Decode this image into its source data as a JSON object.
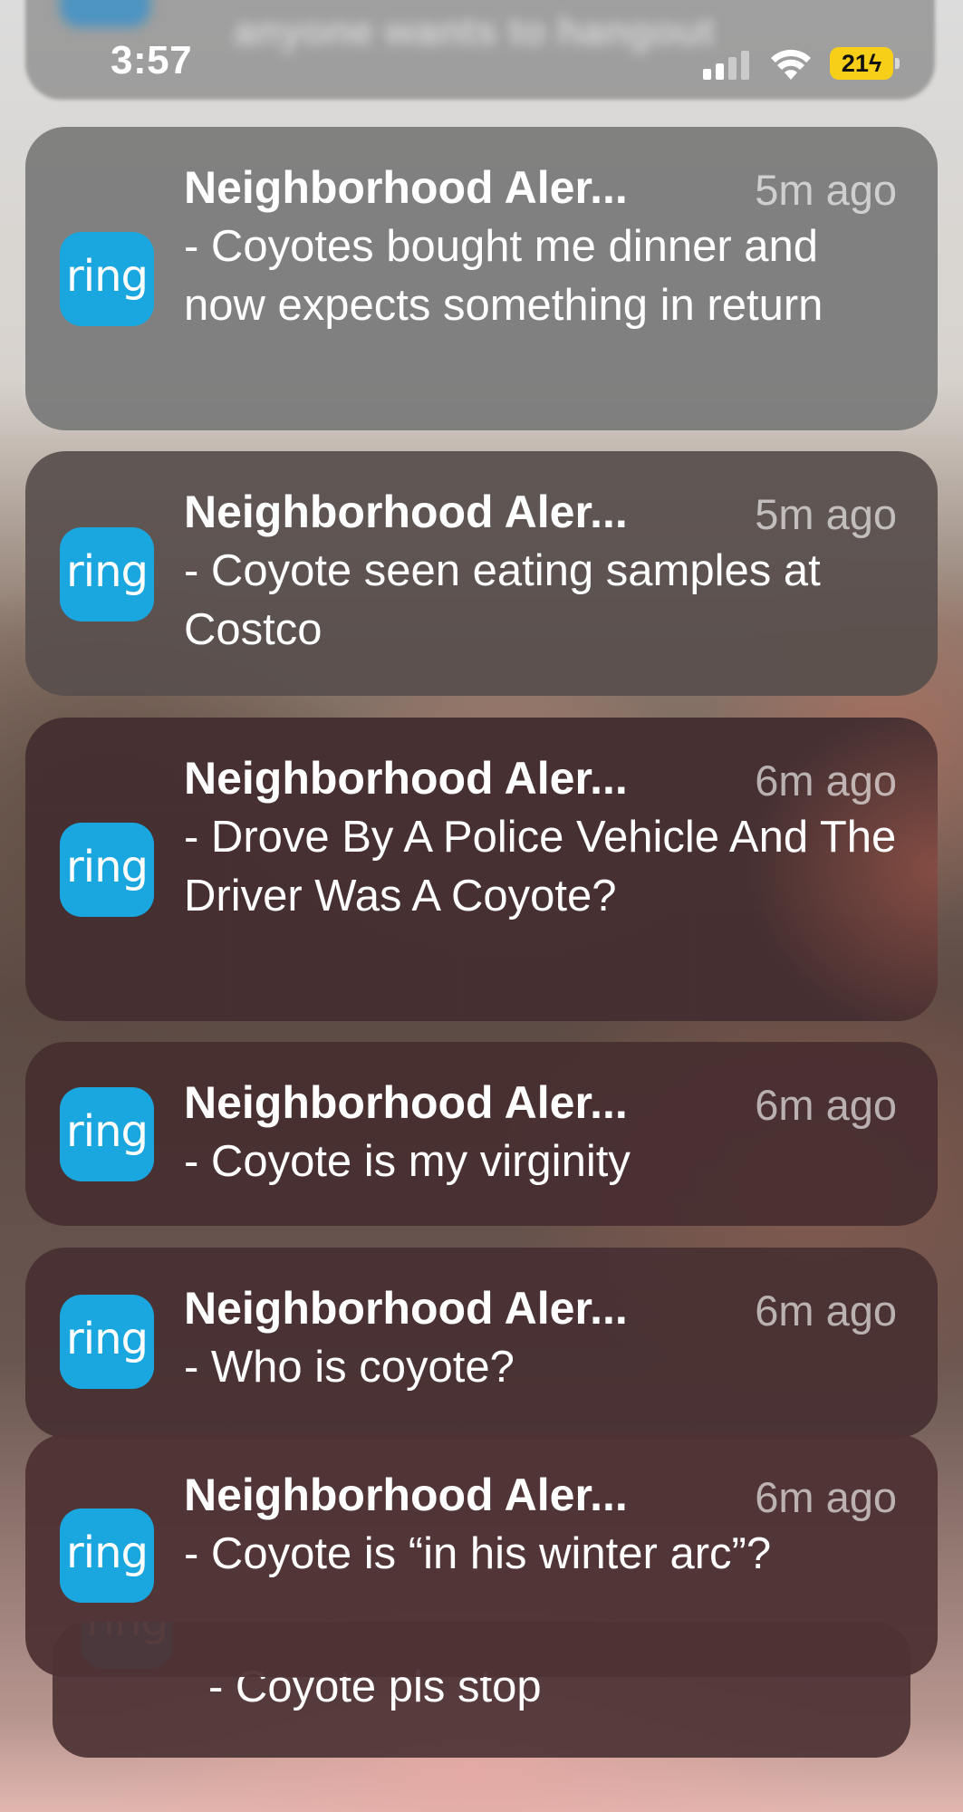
{
  "status_bar": {
    "time": "3:57",
    "battery": "21",
    "charging": true,
    "battery_color": "#f7cf18"
  },
  "top_notification_partial": {
    "body": "anyone wants to hangout"
  },
  "app": {
    "icon_text": "ring",
    "icon_color": "#1aa7e0"
  },
  "notifications": [
    {
      "title": "Neighborhood Aler...",
      "time": "5m ago",
      "body": " - Coyotes bought me dinner and now expects something in return"
    },
    {
      "title": "Neighborhood Aler...",
      "time": "5m ago",
      "body": " - Coyote seen eating samples at Costco"
    },
    {
      "title": "Neighborhood Aler...",
      "time": "6m ago",
      "body": " - Drove By A Police Vehicle And The Driver Was A Coyote?"
    },
    {
      "title": "Neighborhood Aler...",
      "time": "6m ago",
      "body": " - Coyote is my virginity"
    },
    {
      "title": "Neighborhood Aler...",
      "time": "6m ago",
      "body": " - Who is coyote?"
    },
    {
      "title": "Neighborhood Aler...",
      "time": "6m ago",
      "body": " - Coyote is “in his winter arc”?"
    }
  ],
  "stacked_notification": {
    "body": " - Coyote pls stop"
  }
}
